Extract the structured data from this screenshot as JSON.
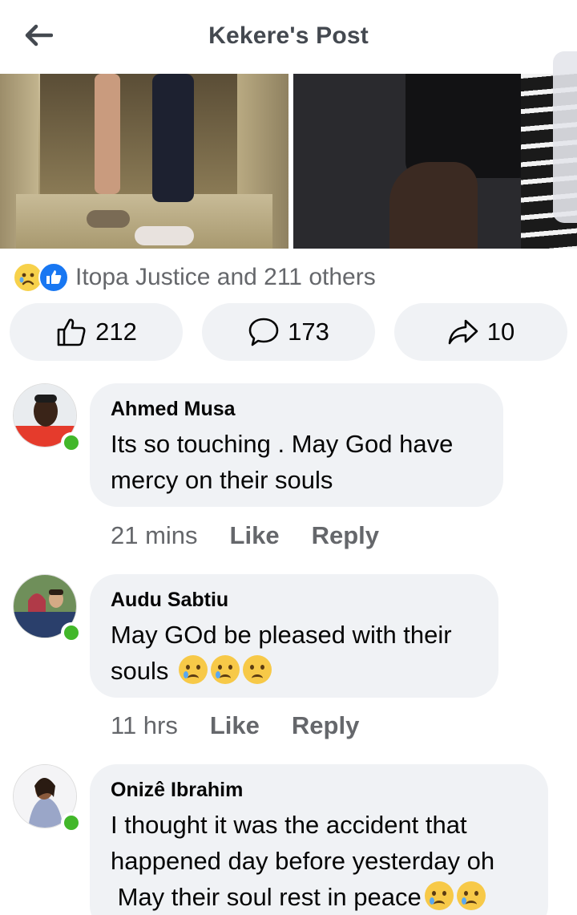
{
  "header": {
    "title": "Kekere's Post",
    "back_icon": "arrow-left-icon"
  },
  "reactions": {
    "summary": "Itopa Justice and 211 others",
    "icons": [
      "sad-reaction-icon",
      "like-reaction-icon"
    ]
  },
  "actions": {
    "likes": "212",
    "comments": "173",
    "shares": "10"
  },
  "comments": [
    {
      "name": "Ahmed Musa",
      "text_lines": [
        "Its so touching . May God have",
        "mercy on their souls"
      ],
      "time": "21 mins",
      "like_label": "Like",
      "reply_label": "Reply"
    },
    {
      "name": "Audu Sabtiu",
      "text_lines": [
        "May GOd be pleased with their",
        "souls"
      ],
      "time": "11 hrs",
      "like_label": "Like",
      "reply_label": "Reply"
    },
    {
      "name": "Onizê Ibrahim",
      "text_lines": [
        "I thought it was the accident that",
        "happened day before yesterday oh",
        " May their soul rest in peace"
      ],
      "time": "",
      "like_label": "",
      "reply_label": ""
    }
  ],
  "colors": {
    "accent": "#1877f2",
    "online": "#42b72a",
    "bubble": "#f0f2f5",
    "muted": "#65676b"
  }
}
